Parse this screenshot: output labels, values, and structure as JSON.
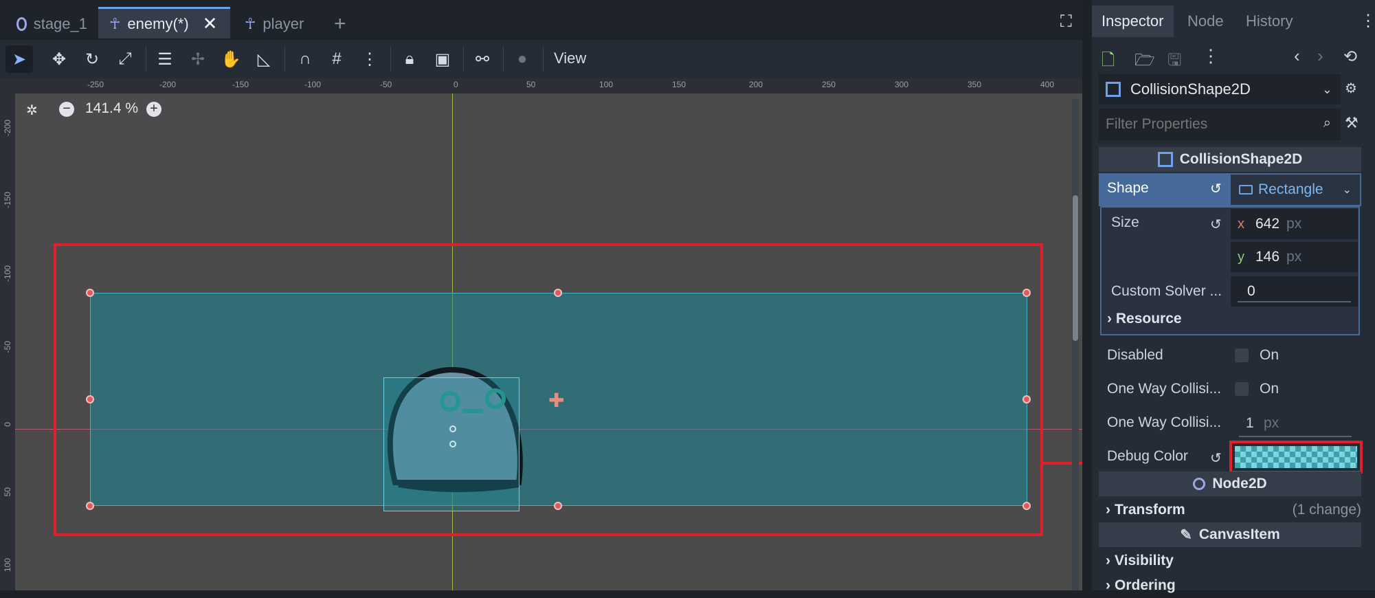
{
  "tabs": [
    {
      "label": "stage_1",
      "icon": "circle-node-icon"
    },
    {
      "label": "enemy(*)",
      "icon": "character-node-icon",
      "active": true
    },
    {
      "label": "player",
      "icon": "character-node-icon"
    }
  ],
  "toolbar": {
    "view_label": "View"
  },
  "viewport": {
    "zoom": "141.4 %",
    "ruler_h": [
      "-250",
      "-200",
      "-150",
      "-100",
      "-50",
      "0",
      "50",
      "100",
      "150",
      "200",
      "250",
      "300",
      "350",
      "400"
    ],
    "ruler_v": [
      "-200",
      "-150",
      "-100",
      "-50",
      "0",
      "50",
      "100"
    ]
  },
  "inspector": {
    "tabs": [
      "Inspector",
      "Node",
      "History"
    ],
    "node_selector": "CollisionShape2D",
    "filter_placeholder": "Filter Properties",
    "section_collision": "CollisionShape2D",
    "shape_label": "Shape",
    "shape_value": "Rectangle",
    "size_label": "Size",
    "size_x": "642",
    "size_y": "146",
    "unit": "px",
    "axis_x": "x",
    "axis_y": "y",
    "custom_solver_label": "Custom Solver ...",
    "custom_solver_value": "0",
    "resource_label": "Resource",
    "disabled_label": "Disabled",
    "disabled_value": "On",
    "one_way_label_1": "One Way Collisi...",
    "one_way_value_1": "On",
    "one_way_label_2": "One Way Collisi...",
    "one_way_value_2": "1",
    "debug_color_label": "Debug Color",
    "section_node2d": "Node2D",
    "transform_label": "Transform",
    "transform_changes": "(1 change)",
    "section_canvasitem": "CanvasItem",
    "visibility_label": "Visibility",
    "ordering_label": "Ordering"
  },
  "colors": {
    "accent": "#6fa0e8",
    "highlight": "#e0202a",
    "shape_fill": "#1f8a9a"
  }
}
